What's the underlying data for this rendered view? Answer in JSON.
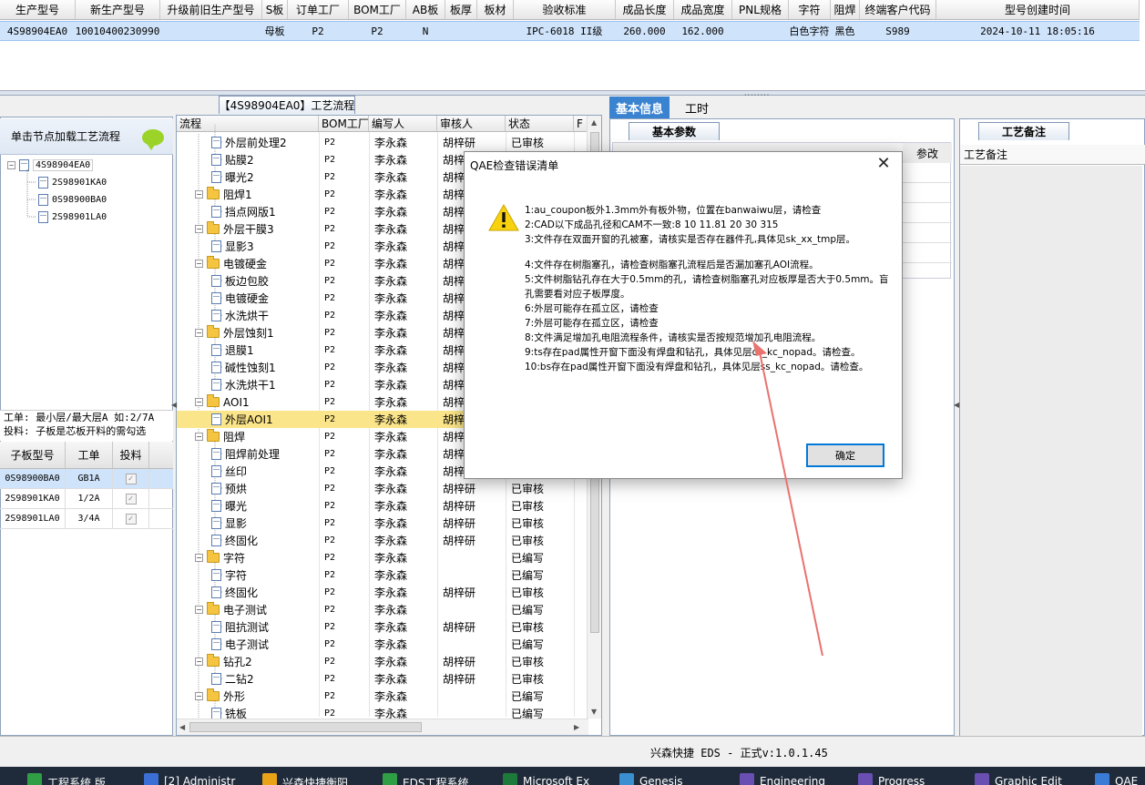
{
  "top_grid": {
    "headers": [
      "生产型号",
      "新生产型号",
      "升级前旧生产型号",
      "S板",
      "订单工厂",
      "BOM工厂",
      "AB板",
      "板厚",
      "板材",
      "验收标准",
      "成品长度",
      "成品宽度",
      "PNL规格",
      "字符",
      "阻焊",
      "终端客户代码",
      "型号创建时间"
    ],
    "row": [
      "4S98904EA0",
      "10010400230990",
      "",
      "母板",
      "P2",
      "P2",
      "N",
      "",
      "",
      "IPC-6018 II级",
      "260.000",
      "162.000",
      "",
      "白色字符",
      "黑色",
      "S989",
      "2024-10-11 18:05:16"
    ]
  },
  "mid_tab_title": "【4S98904EA0】工艺流程",
  "left_panel": {
    "hint": "单击节点加载工艺流程",
    "root": "4S98904EA0",
    "children": [
      "2S98901KA0",
      "0S98900BA0",
      "2S98901LA0"
    ],
    "gongdan_line1": "工单: 最小层/最大层A 如:2/7A",
    "gongdan_line2": "投料: 子板是芯板开料的需勾选",
    "sub_headers": [
      "子板型号",
      "工单",
      "投料"
    ],
    "sub_rows": [
      {
        "model": "0S98900BA0",
        "order": "GB1A",
        "feed": true
      },
      {
        "model": "2S98901KA0",
        "order": "1/2A",
        "feed": true
      },
      {
        "model": "2S98901LA0",
        "order": "3/4A",
        "feed": true
      }
    ]
  },
  "process_grid": {
    "headers": [
      "流程",
      "BOM工厂",
      "编写人",
      "审核人",
      "状态",
      "F"
    ],
    "rows": [
      {
        "name": "外层前处理2",
        "type": "doc",
        "bom": "P2",
        "writer": "李永森",
        "reviewer": "胡梓研",
        "status": "已审核"
      },
      {
        "name": "贴膜2",
        "type": "doc",
        "bom": "P2",
        "writer": "李永森",
        "reviewer": "胡梓研",
        "status": "已审核"
      },
      {
        "name": "曝光2",
        "type": "doc",
        "bom": "P2",
        "writer": "李永森",
        "reviewer": "胡梓研",
        "status": "已审核"
      },
      {
        "name": "阻焊1",
        "type": "folder",
        "bom": "P2",
        "writer": "李永森",
        "reviewer": "胡梓研",
        "status": "已审核"
      },
      {
        "name": "挡点网版1",
        "type": "doc",
        "bom": "P2",
        "writer": "李永森",
        "reviewer": "胡梓研",
        "status": "已审核"
      },
      {
        "name": "外层干膜3",
        "type": "folder",
        "bom": "P2",
        "writer": "李永森",
        "reviewer": "胡梓研",
        "status": "已审核"
      },
      {
        "name": "显影3",
        "type": "doc",
        "bom": "P2",
        "writer": "李永森",
        "reviewer": "胡梓研",
        "status": "已审核"
      },
      {
        "name": "电镀硬金",
        "type": "folder",
        "bom": "P2",
        "writer": "李永森",
        "reviewer": "胡梓研",
        "status": "已审核"
      },
      {
        "name": "板边包胶",
        "type": "doc",
        "bom": "P2",
        "writer": "李永森",
        "reviewer": "胡梓研",
        "status": "已审核"
      },
      {
        "name": "电镀硬金",
        "type": "doc",
        "bom": "P2",
        "writer": "李永森",
        "reviewer": "胡梓研",
        "status": "已审核"
      },
      {
        "name": "水洗烘干",
        "type": "doc",
        "bom": "P2",
        "writer": "李永森",
        "reviewer": "胡梓研",
        "status": "已审核"
      },
      {
        "name": "外层蚀刻1",
        "type": "folder",
        "bom": "P2",
        "writer": "李永森",
        "reviewer": "胡梓研",
        "status": "已审核"
      },
      {
        "name": "退膜1",
        "type": "doc",
        "bom": "P2",
        "writer": "李永森",
        "reviewer": "胡梓研",
        "status": "已审核"
      },
      {
        "name": "碱性蚀刻1",
        "type": "doc",
        "bom": "P2",
        "writer": "李永森",
        "reviewer": "胡梓研",
        "status": "已审核"
      },
      {
        "name": "水洗烘干1",
        "type": "doc",
        "bom": "P2",
        "writer": "李永森",
        "reviewer": "胡梓研",
        "status": "已审核"
      },
      {
        "name": "AOI1",
        "type": "folder",
        "bom": "P2",
        "writer": "李永森",
        "reviewer": "胡梓研",
        "status": "已审核"
      },
      {
        "name": "外层AOI1",
        "type": "doc",
        "bom": "P2",
        "writer": "李永森",
        "reviewer": "胡梓研",
        "status": "已审核",
        "selected": true
      },
      {
        "name": "阻焊",
        "type": "folder",
        "bom": "P2",
        "writer": "李永森",
        "reviewer": "胡梓研",
        "status": "已审核"
      },
      {
        "name": "阻焊前处理",
        "type": "doc",
        "bom": "P2",
        "writer": "李永森",
        "reviewer": "胡梓研",
        "status": "已审核"
      },
      {
        "name": "丝印",
        "type": "doc",
        "bom": "P2",
        "writer": "李永森",
        "reviewer": "胡梓研",
        "status": "已审核"
      },
      {
        "name": "预烘",
        "type": "doc",
        "bom": "P2",
        "writer": "李永森",
        "reviewer": "胡梓研",
        "status": "已审核"
      },
      {
        "name": "曝光",
        "type": "doc",
        "bom": "P2",
        "writer": "李永森",
        "reviewer": "胡梓研",
        "status": "已审核"
      },
      {
        "name": "显影",
        "type": "doc",
        "bom": "P2",
        "writer": "李永森",
        "reviewer": "胡梓研",
        "status": "已审核"
      },
      {
        "name": "终固化",
        "type": "doc",
        "bom": "P2",
        "writer": "李永森",
        "reviewer": "胡梓研",
        "status": "已审核"
      },
      {
        "name": "字符",
        "type": "folder",
        "bom": "P2",
        "writer": "李永森",
        "reviewer": "",
        "status": "已编写"
      },
      {
        "name": "字符",
        "type": "doc",
        "bom": "P2",
        "writer": "李永森",
        "reviewer": "",
        "status": "已编写"
      },
      {
        "name": "终固化",
        "type": "doc",
        "bom": "P2",
        "writer": "李永森",
        "reviewer": "胡梓研",
        "status": "已审核"
      },
      {
        "name": "电子测试",
        "type": "folder",
        "bom": "P2",
        "writer": "李永森",
        "reviewer": "",
        "status": "已编写"
      },
      {
        "name": "阻抗测试",
        "type": "doc",
        "bom": "P2",
        "writer": "李永森",
        "reviewer": "胡梓研",
        "status": "已审核"
      },
      {
        "name": "电子测试",
        "type": "doc",
        "bom": "P2",
        "writer": "李永森",
        "reviewer": "",
        "status": "已编写"
      },
      {
        "name": "钻孔2",
        "type": "folder",
        "bom": "P2",
        "writer": "李永森",
        "reviewer": "胡梓研",
        "status": "已审核"
      },
      {
        "name": "二钻2",
        "type": "doc",
        "bom": "P2",
        "writer": "李永森",
        "reviewer": "胡梓研",
        "status": "已审核"
      },
      {
        "name": "外形",
        "type": "folder",
        "bom": "P2",
        "writer": "李永森",
        "reviewer": "",
        "status": "已编写"
      },
      {
        "name": "铣板",
        "type": "doc",
        "bom": "P2",
        "writer": "李永森",
        "reviewer": "",
        "status": "已编写"
      }
    ]
  },
  "right_tabs": {
    "basic": "基本信息",
    "hours": "工时",
    "sub": "基本参数",
    "col_partial": "参改"
  },
  "note_panel": {
    "tab": "工艺备注",
    "header": "工艺备注"
  },
  "status_bar": "兴森快捷 EDS - 正式v:1.0.1.45",
  "dialog": {
    "title": "QAE检查错误清单",
    "close": "✕",
    "messages": [
      "1:au_coupon板外1.3mm外有板外物，位置在banwaiwu层，请检查",
      "2:CAD以下成品孔径和CAM不一致:8 10 11.81 20 30 315",
      "3:文件存在双面开窗的孔被塞，请核实是否存在器件孔,具体见sk_xx_tmp层。",
      "",
      "4:文件存在树脂塞孔，请检查树脂塞孔流程后是否漏加塞孔AOI流程。",
      "5:文件树脂钻孔存在大于0.5mm的孔，请检查树脂塞孔对应板厚是否大于0.5mm。盲孔需要看对应子板厚度。",
      "6:外层可能存在孤立区，请检查",
      "7:外层可能存在孤立区，请检查",
      "8:文件满足增加孔电阻流程条件，请核实是否按规范增加孔电阻流程。",
      "9:ts存在pad属性开窗下面没有焊盘和钻孔，具体见层cs_kc_nopad。请检查。",
      "10:bs存在pad属性开窗下面没有焊盘和钻孔，具体见层ss_kc_nopad。请检查。"
    ],
    "ok": "确定"
  },
  "taskbar": [
    {
      "label": "工程系统 版",
      "color": "#2f9e44"
    },
    {
      "label": "[2] Administr",
      "color": "#3b6fd6"
    },
    {
      "label": "兴森快捷衡阳",
      "color": "#e8a317"
    },
    {
      "label": "EDS工程系统",
      "color": "#2f9e44"
    },
    {
      "label": "Microsoft Ex",
      "color": "#1d7a3a"
    },
    {
      "label": "Genesis",
      "color": "#3a8fd0"
    },
    {
      "label": "Engineering",
      "color": "#6a4fb3"
    },
    {
      "label": "Progress",
      "color": "#6a4fb3"
    },
    {
      "label": "Graphic Edit",
      "color": "#6a4fb3"
    },
    {
      "label": "QAE",
      "color": "#3a7bd5"
    }
  ],
  "colors": {
    "selection": "#cfe3fa",
    "highlight_row": "#fbe58a",
    "accent": "#3a83d0",
    "annotation_arrow": "#e8736f"
  }
}
